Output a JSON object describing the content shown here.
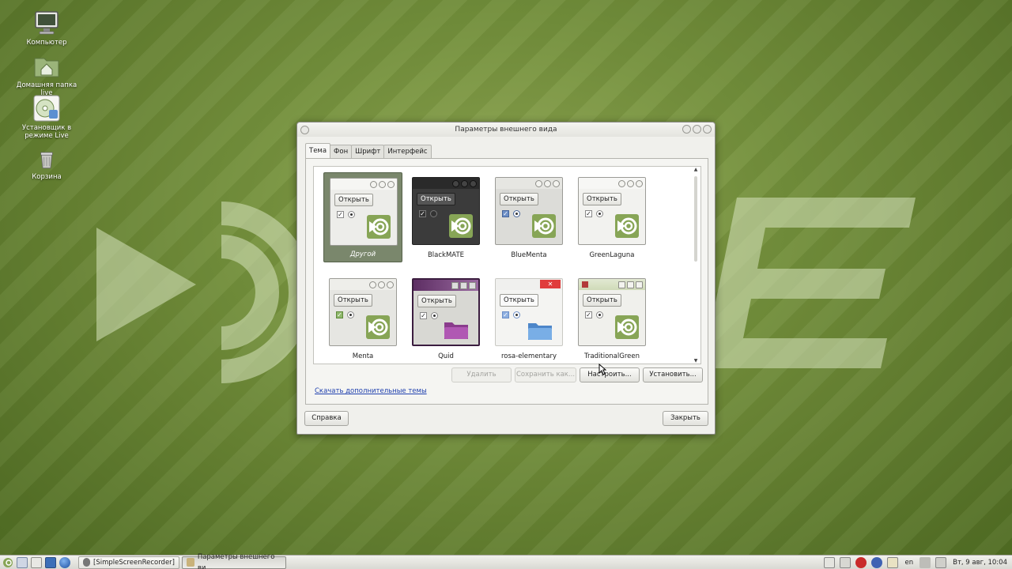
{
  "desktop": {
    "icons": [
      {
        "label": "Компьютер"
      },
      {
        "label": "Домашняя папка live"
      },
      {
        "label": "Установщик в режиме Live"
      },
      {
        "label": "Корзина"
      }
    ]
  },
  "window": {
    "title": "Параметры внешнего вида",
    "tabs": [
      "Тема",
      "Фон",
      "Шрифт",
      "Интерфейс"
    ],
    "active_tab": "Тема",
    "preview_button_label": "Открыть",
    "themes": [
      {
        "name": "Другой",
        "selected": true,
        "style": "default"
      },
      {
        "name": "BlackMATE",
        "selected": false,
        "style": "dark"
      },
      {
        "name": "BlueMenta",
        "selected": false,
        "style": "blue"
      },
      {
        "name": "GreenLaguna",
        "selected": false,
        "style": "default"
      },
      {
        "name": "Menta",
        "selected": false,
        "style": "default"
      },
      {
        "name": "Quid",
        "selected": false,
        "style": "purple"
      },
      {
        "name": "rosa-elementary",
        "selected": false,
        "style": "elementary"
      },
      {
        "name": "TraditionalGreen",
        "selected": false,
        "style": "traditional"
      }
    ],
    "buttons": {
      "delete": "Удалить",
      "save_as": "Сохранить как...",
      "customize": "Настроить...",
      "install": "Установить..."
    },
    "more_themes_link": "Скачать дополнительные темы",
    "help": "Справка",
    "close": "Закрыть"
  },
  "taskbar": {
    "tasks": [
      "[SimpleScreenRecorder]",
      "Параметры внешнего ви..."
    ],
    "active_task": 1,
    "keyboard_layout": "en",
    "clock": "Вт,  9 авг, 10:04"
  },
  "colors": {
    "accent_green": "#87a556",
    "selected_bg": "#7a876c",
    "link": "#1e3fae"
  }
}
